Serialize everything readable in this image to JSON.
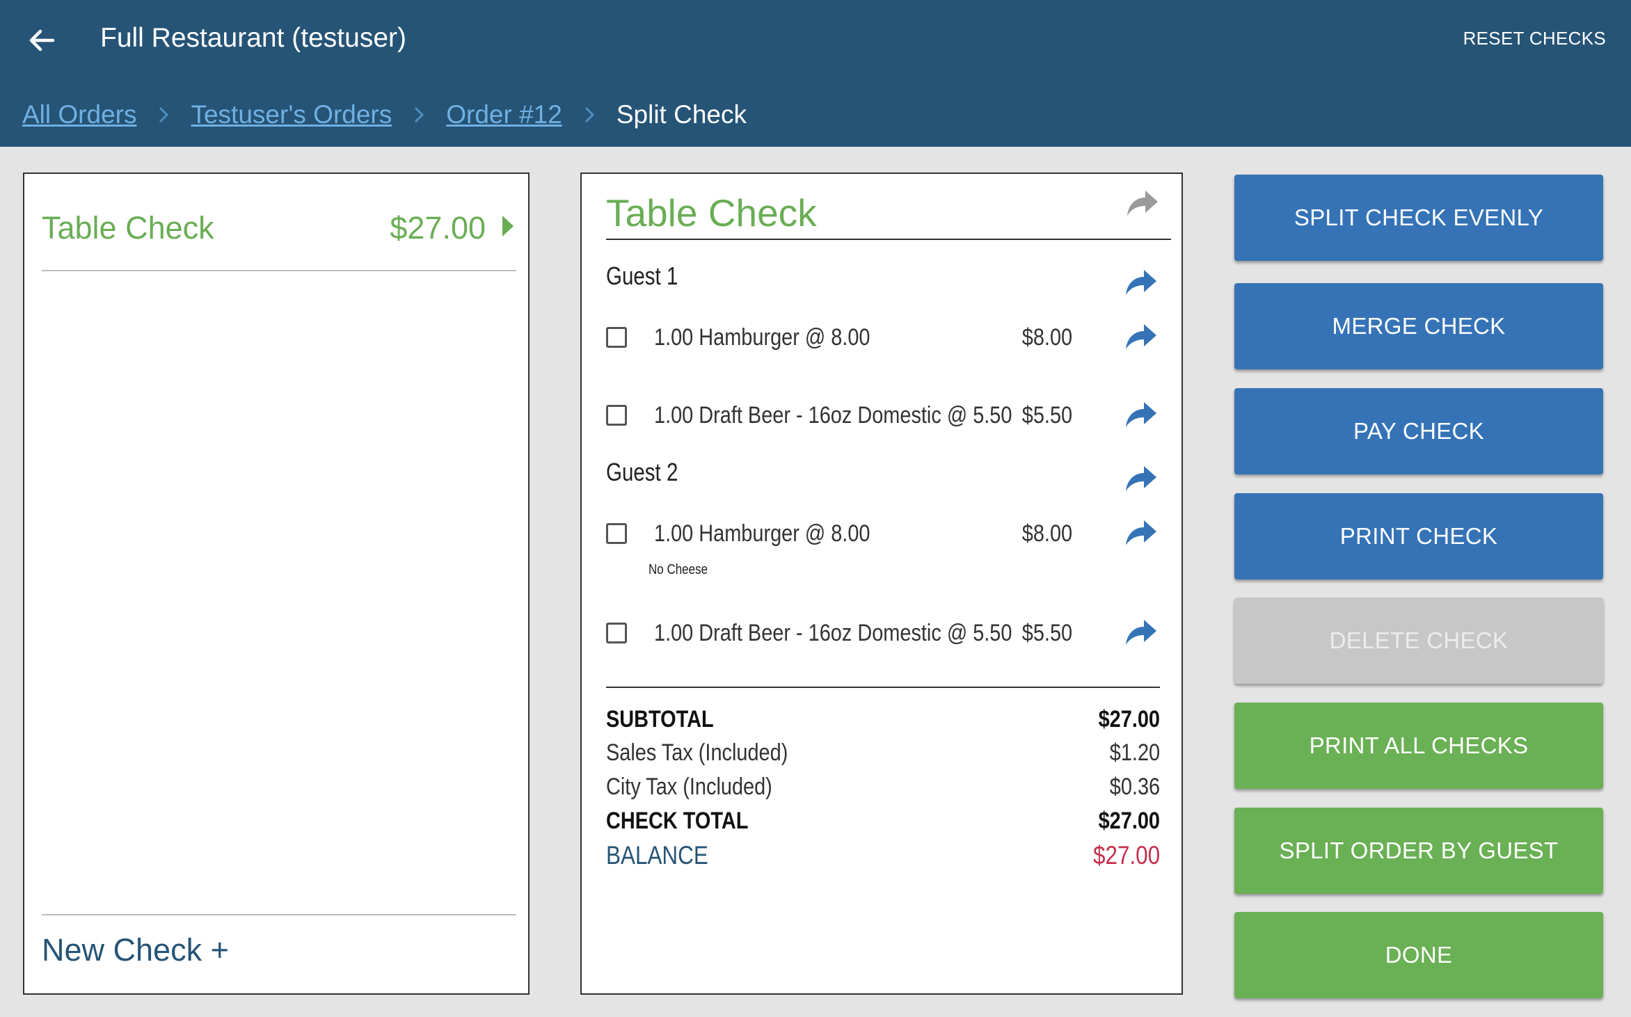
{
  "header": {
    "title": "Full Restaurant (testuser)",
    "reset_label": "RESET CHECKS"
  },
  "breadcrumb": {
    "items": [
      "All Orders",
      "Testuser's Orders",
      "Order #12"
    ],
    "current": "Split Check"
  },
  "checks_list": {
    "items": [
      {
        "name": "Table Check",
        "amount": "$27.00"
      }
    ],
    "new_check_label": "New Check +"
  },
  "check_detail": {
    "title": "Table Check",
    "guests": [
      {
        "label": "Guest 1",
        "items": [
          {
            "desc": "1.00 Hamburger @  8.00",
            "price": "$8.00",
            "modifier": ""
          },
          {
            "desc": "1.00 Draft Beer - 16oz Domestic @  5.50",
            "price": "$5.50",
            "modifier": ""
          }
        ]
      },
      {
        "label": "Guest 2",
        "items": [
          {
            "desc": "1.00 Hamburger @  8.00",
            "price": "$8.00",
            "modifier": "No Cheese"
          },
          {
            "desc": "1.00 Draft Beer - 16oz Domestic @  5.50",
            "price": "$5.50",
            "modifier": ""
          }
        ]
      }
    ],
    "totals": {
      "subtotal_label": "SUBTOTAL",
      "subtotal": "$27.00",
      "sales_tax_label": "Sales Tax (Included)",
      "sales_tax": "$1.20",
      "city_tax_label": "City Tax (Included)",
      "city_tax": "$0.36",
      "check_total_label": "CHECK TOTAL",
      "check_total": "$27.00",
      "balance_label": "BALANCE",
      "balance": "$27.00"
    }
  },
  "actions": {
    "split_evenly": "SPLIT CHECK EVENLY",
    "merge": "MERGE CHECK",
    "pay": "PAY CHECK",
    "print": "PRINT CHECK",
    "delete": "DELETE CHECK",
    "print_all": "PRINT ALL CHECKS",
    "split_by_guest": "SPLIT ORDER BY GUEST",
    "done": "DONE"
  },
  "colors": {
    "header_bg": "#265476",
    "accent_green": "#6aad55",
    "button_blue": "#3573b6",
    "button_green": "#6ab055",
    "button_disabled": "#c7c7c7",
    "balance_red": "#c42f4d"
  },
  "icons": [
    "back-arrow-icon",
    "chevron-right-icon",
    "caret-right-icon",
    "share-arrow-icon"
  ]
}
